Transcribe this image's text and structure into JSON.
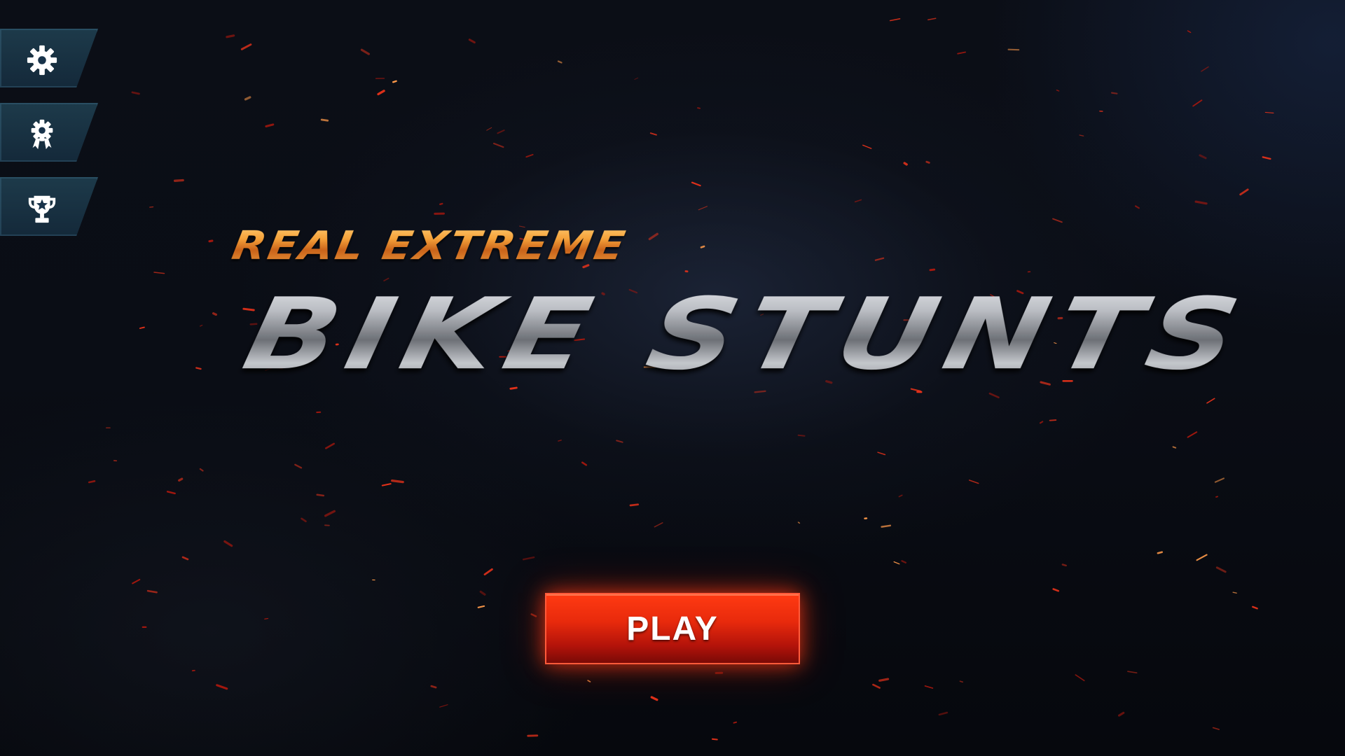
{
  "game": {
    "title_top": "REAL EXTREME",
    "title_main": "BIKE STUNTS"
  },
  "side_menu": {
    "items": [
      {
        "icon": "gear-icon",
        "purpose": "settings"
      },
      {
        "icon": "award-ribbon-icon",
        "purpose": "achievements"
      },
      {
        "icon": "trophy-icon",
        "purpose": "leaderboard"
      }
    ]
  },
  "play_button": {
    "label": "PLAY"
  },
  "colors": {
    "accent_orange": "#e38a22",
    "play_red": "#e82a0c",
    "menu_plate": "#1d3a4a",
    "background": "#0a0d15"
  }
}
